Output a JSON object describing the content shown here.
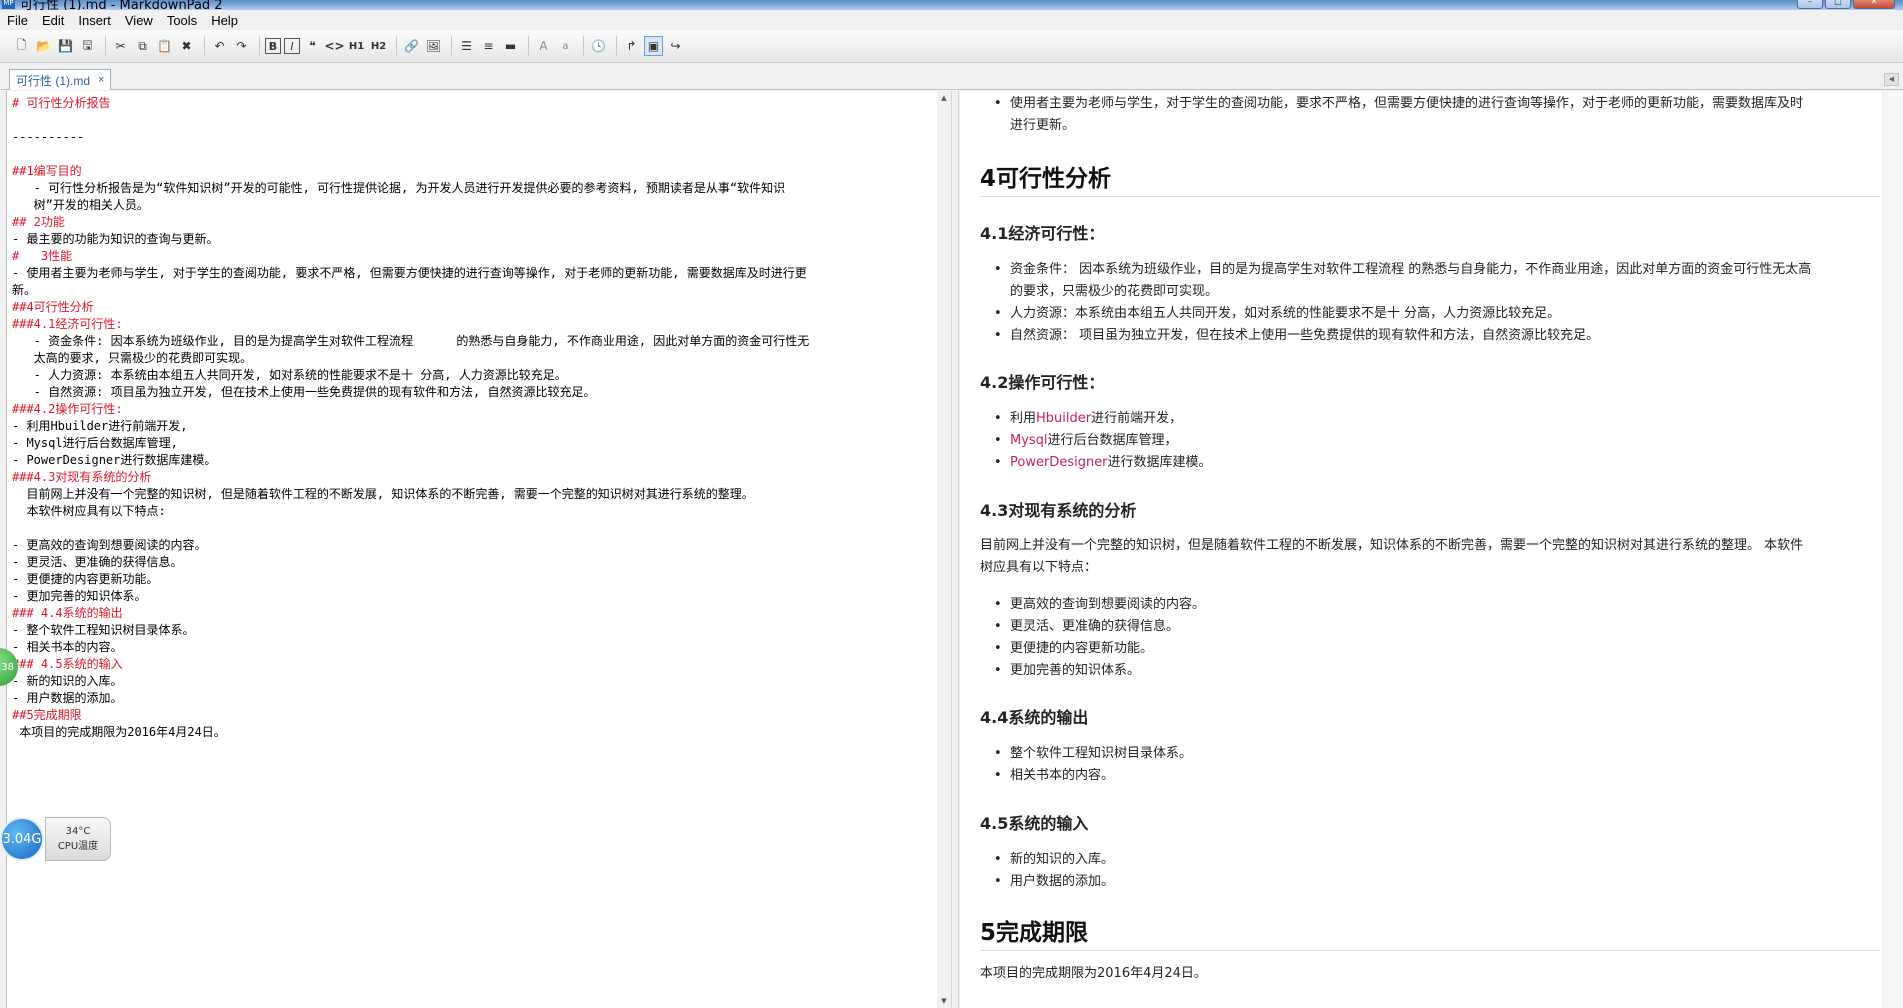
{
  "window": {
    "title": "可行性 (1).md - MarkdownPad 2",
    "app_icon": "MP",
    "controls": [
      "minimize-icon",
      "maximize-icon",
      "close-icon"
    ]
  },
  "menu": [
    "File",
    "Edit",
    "Insert",
    "View",
    "Tools",
    "Help"
  ],
  "toolbar": {
    "icons": [
      "new-file-icon",
      "open-folder-icon",
      "save-icon",
      "save-all-icon",
      "cut-icon",
      "copy-icon",
      "paste-icon",
      "delete-icon",
      "undo-icon",
      "redo-icon",
      "bold-icon",
      "italic-icon",
      "quote-icon",
      "code-icon",
      "heading1-icon",
      "heading2-icon",
      "link-icon",
      "image-icon",
      "unordered-list-icon",
      "ordered-list-icon",
      "horizontal-rule-icon",
      "uppercase-icon",
      "lowercase-icon",
      "timestamp-icon",
      "toggle-preview-icon",
      "live-preview-icon",
      "export-icon"
    ],
    "labels": {
      "bold": "B",
      "italic": "I",
      "quote": "❝",
      "code": "<>",
      "h1": "H1",
      "h2": "H2",
      "upper": "A",
      "lower": "a"
    }
  },
  "tab": {
    "title": "可行性 (1).md",
    "close": "×"
  },
  "editor": {
    "lines": [
      {
        "text": "# 可行性分析报告",
        "heading": true
      },
      {
        "text": "",
        "heading": false
      },
      {
        "text": "----------",
        "heading": false
      },
      {
        "text": "",
        "heading": false
      },
      {
        "text": "##1编写目的",
        "heading": true
      },
      {
        "text": "   - 可行性分析报告是为“软件知识树”开发的可能性, 可行性提供论据, 为开发人员进行开发提供必要的参考资料, 预期读者是从事“软件知识",
        "heading": false
      },
      {
        "text": "   树”开发的相关人员。",
        "heading": false
      },
      {
        "text": "## 2功能",
        "heading": true
      },
      {
        "text": "- 最主要的功能为知识的查询与更新。",
        "heading": false
      },
      {
        "text": "#   3性能",
        "heading": true
      },
      {
        "text": "- 使用者主要为老师与学生, 对于学生的查阅功能, 要求不严格, 但需要方便快捷的进行查询等操作, 对于老师的更新功能, 需要数据库及时进行更",
        "heading": false
      },
      {
        "text": "新。",
        "heading": false
      },
      {
        "text": "##4可行性分析",
        "heading": true
      },
      {
        "text": "###4.1经济可行性:",
        "heading": true
      },
      {
        "text": "   - 资金条件: 因本系统为班级作业, 目的是为提高学生对软件工程流程      的熟悉与自身能力, 不作商业用途, 因此对单方面的资金可行性无",
        "heading": false
      },
      {
        "text": "   太高的要求, 只需极少的花费即可实现。",
        "heading": false
      },
      {
        "text": "   - 人力资源: 本系统由本组五人共同开发, 如对系统的性能要求不是十 分高, 人力资源比较充足。",
        "heading": false
      },
      {
        "text": "   - 自然资源: 项目虽为独立开发, 但在技术上使用一些免费提供的现有软件和方法, 自然资源比较充足。",
        "heading": false
      },
      {
        "text": "###4.2操作可行性:",
        "heading": true
      },
      {
        "text": "- 利用Hbuilder进行前端开发,",
        "heading": false
      },
      {
        "text": "- Mysql进行后台数据库管理,",
        "heading": false
      },
      {
        "text": "- PowerDesigner进行数据库建模。",
        "heading": false
      },
      {
        "text": "###4.3对现有系统的分析",
        "heading": true
      },
      {
        "text": "  目前网上并没有一个完整的知识树, 但是随着软件工程的不断发展, 知识体系的不断完善, 需要一个完整的知识树对其进行系统的整理。",
        "heading": false
      },
      {
        "text": "  本软件树应具有以下特点:",
        "heading": false
      },
      {
        "text": "",
        "heading": false
      },
      {
        "text": "- 更高效的查询到想要阅读的内容。",
        "heading": false
      },
      {
        "text": "- 更灵活、更准确的获得信息。",
        "heading": false
      },
      {
        "text": "- 更便捷的内容更新功能。",
        "heading": false
      },
      {
        "text": "- 更加完善的知识体系。",
        "heading": false
      },
      {
        "text": "### 4.4系统的输出",
        "heading": true
      },
      {
        "text": "- 整个软件工程知识树目录体系。",
        "heading": false
      },
      {
        "text": "- 相关书本的内容。",
        "heading": false
      },
      {
        "text": "### 4.5系统的输入",
        "heading": true
      },
      {
        "text": "- 新的知识的入库。",
        "heading": false
      },
      {
        "text": "- 用户数据的添加。",
        "heading": false
      },
      {
        "text": "##5完成期限",
        "heading": true
      },
      {
        "text": " 本项目的完成期限为2016年4月24日。",
        "heading": false
      }
    ]
  },
  "preview": {
    "perf_bullet": "使用者主要为老师与学生，对于学生的查阅功能，要求不严格，但需要方便快捷的进行查询等操作，对于老师的更新功能，需要数据库及时",
    "perf_bullet_cont": "进行更新。",
    "h_feasibility": "4可行性分析",
    "h_econ": "4.1经济可行性：",
    "econ_items": [
      "资金条件：  因本系统为班级作业，目的是为提高学生对软件工程流程 的熟悉与自身能力，不作商业用途，因此对单方面的资金可行性无太高",
      "的要求，只需极少的花费即可实现。",
      "人力资源：本系统由本组五人共同开发，如对系统的性能要求不是十 分高，人力资源比较充足。",
      "自然资源：  项目虽为独立开发，但在技术上使用一些免费提供的现有软件和方法，自然资源比较充足。"
    ],
    "h_ops": "4.2操作可行性：",
    "ops_items": [
      {
        "code": "Hbuilder",
        "pre": "利用",
        "post": "进行前端开发，"
      },
      {
        "code": "Mysql",
        "pre": "",
        "post": "进行后台数据库管理，"
      },
      {
        "code": "PowerDesigner",
        "pre": "",
        "post": "进行数据库建模。"
      }
    ],
    "h_analysis": "4.3对现有系统的分析",
    "analysis_p1": "目前网上并没有一个完整的知识树，但是随着软件工程的不断发展，知识体系的不断完善，需要一个完整的知识树对其进行系统的整理。 本软件",
    "analysis_p2": "树应具有以下特点：",
    "analysis_items": [
      "更高效的查询到想要阅读的内容。",
      "更灵活、更准确的获得信息。",
      "更便捷的内容更新功能。",
      "更加完善的知识体系。"
    ],
    "h_output": "4.4系统的输出",
    "output_items": [
      "整个软件工程知识树目录体系。",
      "相关书本的内容。"
    ],
    "h_input": "4.5系统的输入",
    "input_items": [
      "新的知识的入库。",
      "用户数据的添加。"
    ],
    "h_deadline": "5完成期限",
    "deadline_p": "本项目的完成期限为2016年4月24日。"
  },
  "overlay": {
    "green_badge": "38",
    "speed": "3.04G",
    "cpu_temp": "34°C",
    "cpu_label": "CPU温度"
  }
}
